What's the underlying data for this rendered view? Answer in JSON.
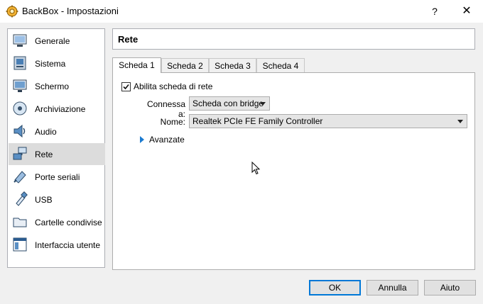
{
  "window": {
    "title": "BackBox - Impostazioni",
    "help_label": "?",
    "close_label": "✕"
  },
  "sidebar": {
    "items": [
      {
        "label": "Generale",
        "icon": "general-icon"
      },
      {
        "label": "Sistema",
        "icon": "system-icon"
      },
      {
        "label": "Schermo",
        "icon": "display-icon"
      },
      {
        "label": "Archiviazione",
        "icon": "storage-icon"
      },
      {
        "label": "Audio",
        "icon": "audio-icon"
      },
      {
        "label": "Rete",
        "icon": "network-icon",
        "selected": true
      },
      {
        "label": "Porte seriali",
        "icon": "serial-ports-icon"
      },
      {
        "label": "USB",
        "icon": "usb-icon"
      },
      {
        "label": "Cartelle condivise",
        "icon": "shared-folders-icon"
      },
      {
        "label": "Interfaccia utente",
        "icon": "user-interface-icon"
      }
    ]
  },
  "page": {
    "title": "Rete"
  },
  "tabs": [
    {
      "label": "Scheda 1",
      "active": true
    },
    {
      "label": "Scheda 2"
    },
    {
      "label": "Scheda 3"
    },
    {
      "label": "Scheda 4"
    }
  ],
  "adapter": {
    "enable_label": "Abilita scheda di rete",
    "enabled": true,
    "attached_label": "Connessa a:",
    "attached_value": "Scheda con bridge",
    "name_label": "Nome:",
    "name_value": "Realtek PCIe FE Family Controller",
    "advanced_label": "Avanzate"
  },
  "buttons": {
    "ok": "OK",
    "cancel": "Annulla",
    "help": "Aiuto"
  },
  "colors": {
    "accent": "#0078d7",
    "selected_bg": "#dcdcdc"
  }
}
